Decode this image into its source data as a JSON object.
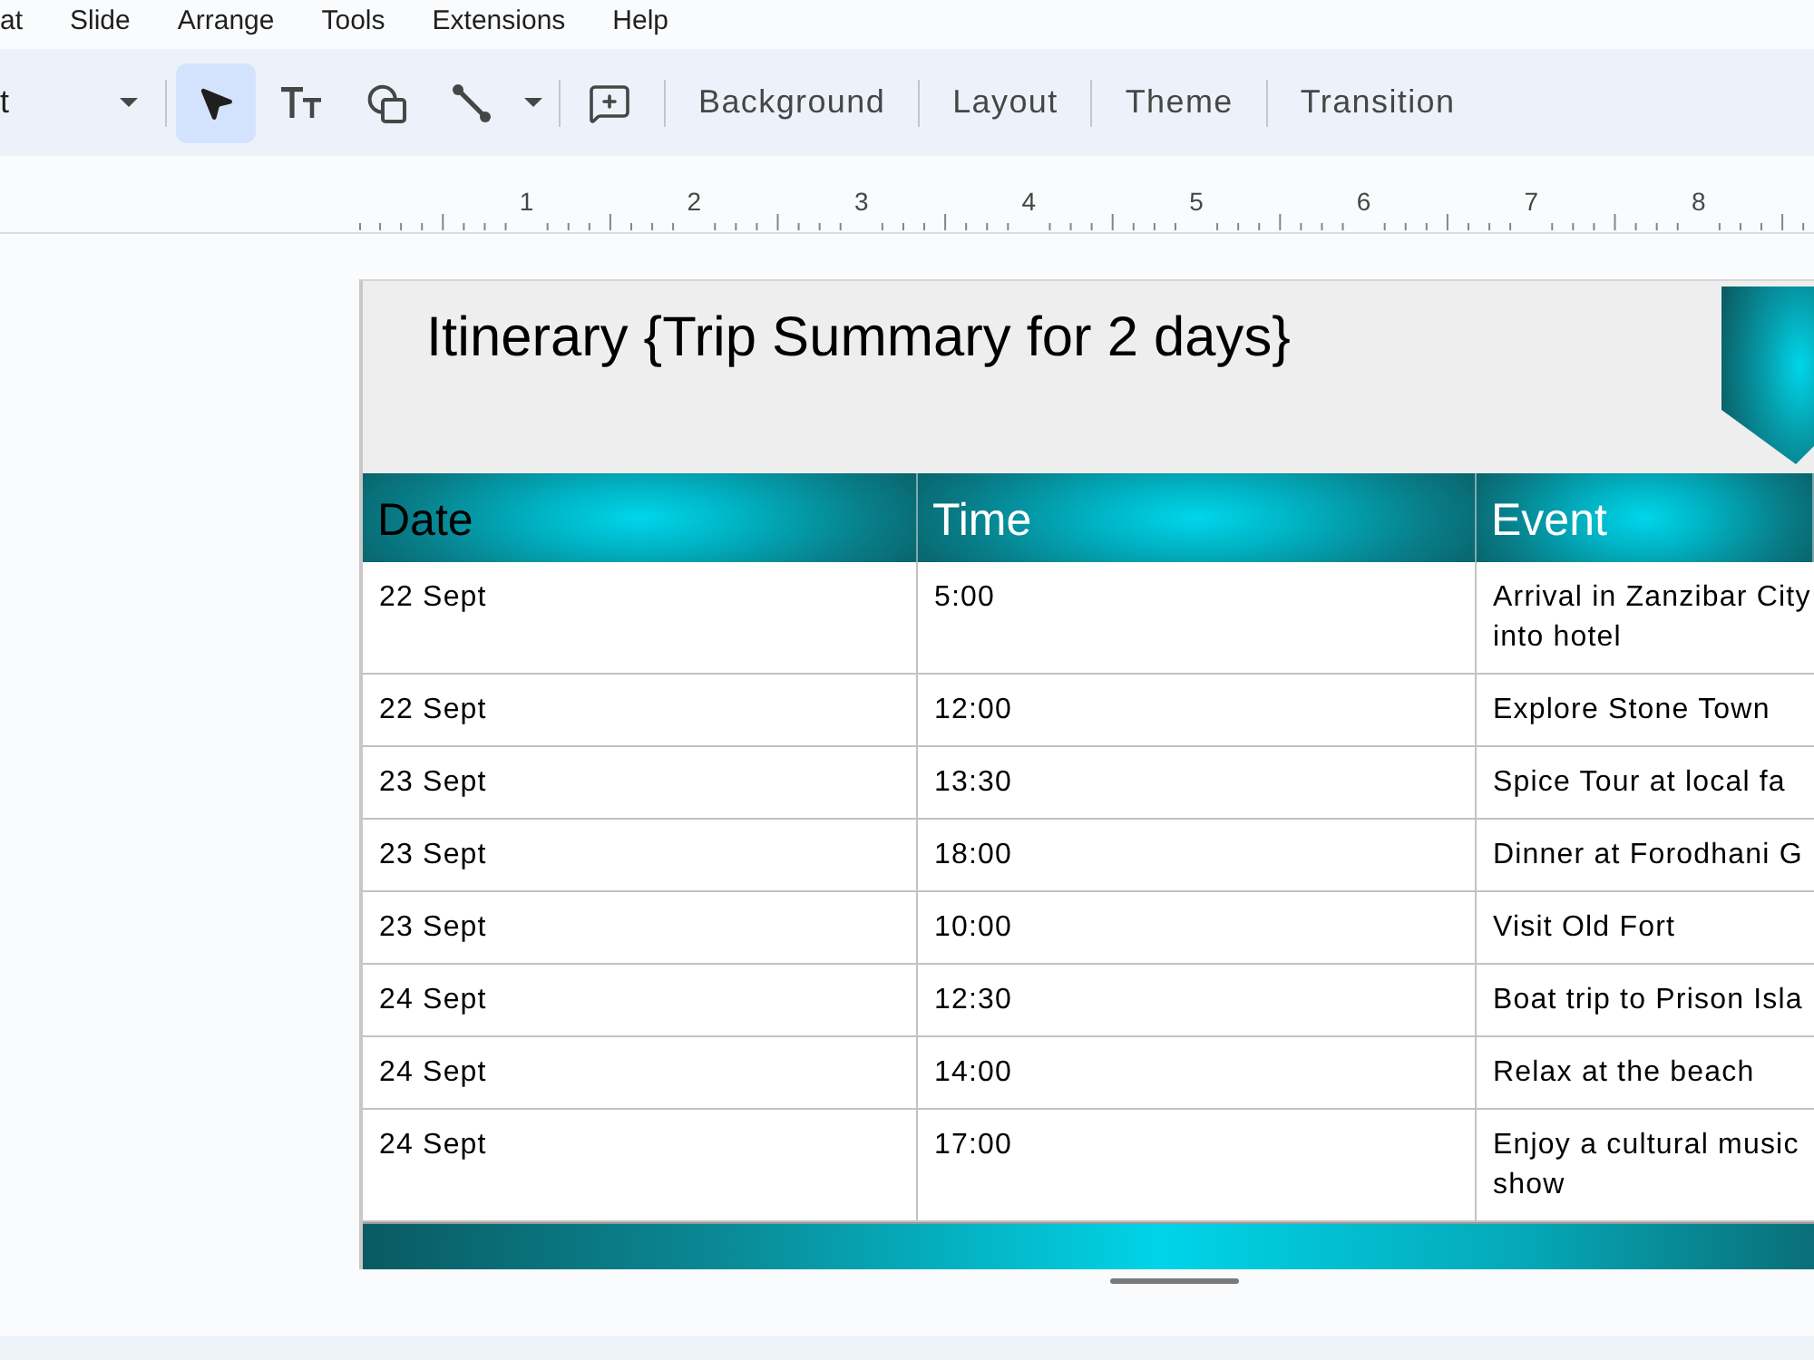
{
  "menu_bar": {
    "items": [
      "at",
      "Slide",
      "Arrange",
      "Tools",
      "Extensions",
      "Help"
    ]
  },
  "toolbar": {
    "zoom": {
      "value": "t"
    },
    "tools": [
      {
        "kind": "select",
        "selected": true
      },
      {
        "kind": "text",
        "selected": false
      },
      {
        "kind": "shape",
        "selected": false
      },
      {
        "kind": "line",
        "selected": false
      }
    ],
    "buttons": [
      "Background",
      "Layout",
      "Theme",
      "Transition"
    ]
  },
  "ruler": {
    "labels": [
      "1",
      "2",
      "3",
      "4",
      "5",
      "6",
      "7",
      "8"
    ]
  },
  "slide": {
    "title": "Itinerary {Trip Summary for 2 days}",
    "table": {
      "columns": [
        {
          "label": "Date",
          "color": "#000000"
        },
        {
          "label": "Time",
          "color": "#ffffff"
        },
        {
          "label": "Event",
          "color": "#ffffff"
        }
      ],
      "rows": [
        {
          "date": "22 Sept",
          "time": "5:00",
          "event": "Arrival in Zanzibar City\ninto hotel"
        },
        {
          "date": "22 Sept",
          "time": "12:00",
          "event": "Explore Stone Town"
        },
        {
          "date": "23 Sept",
          "time": "13:30",
          "event": "Spice Tour at local fa"
        },
        {
          "date": "23 Sept",
          "time": "18:00",
          "event": "Dinner at Forodhani G"
        },
        {
          "date": "23 Sept",
          "time": "10:00",
          "event": "Visit Old Fort"
        },
        {
          "date": "24 Sept",
          "time": "12:30",
          "event": "Boat trip to Prison Isla"
        },
        {
          "date": "24 Sept",
          "time": "14:00",
          "event": "Relax at the beach"
        },
        {
          "date": "24 Sept",
          "time": "17:00",
          "event": "Enjoy a cultural music\nshow"
        }
      ]
    }
  }
}
